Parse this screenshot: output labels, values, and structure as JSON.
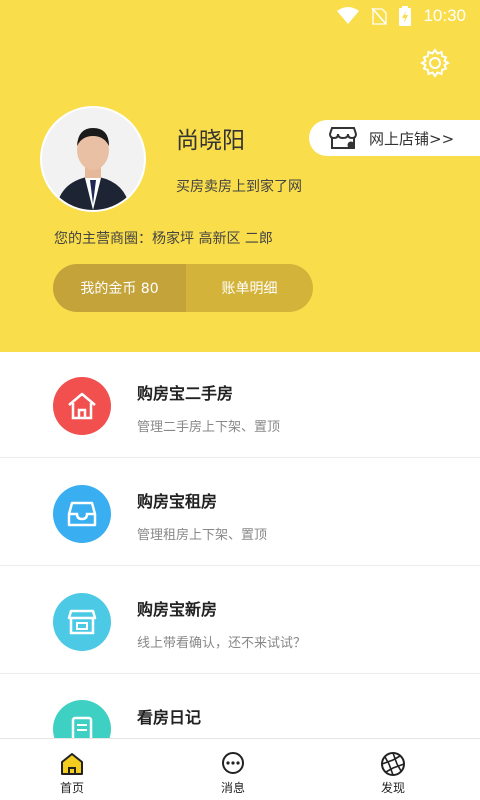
{
  "status": {
    "time": "10:30"
  },
  "profile": {
    "name": "尚晓阳",
    "slogan": "买房卖房上到家了网",
    "district": "您的主营商圈：杨家坪  高新区  二郎"
  },
  "shop": {
    "label": "网上店铺>>"
  },
  "coins": {
    "coins_label": "我的金币 80",
    "bill_label": "账单明细"
  },
  "services": [
    {
      "title": "购房宝二手房",
      "desc": "管理二手房上下架、置顶",
      "color": "#f1504f"
    },
    {
      "title": "购房宝租房",
      "desc": "管理租房上下架、置顶",
      "color": "#39aef0"
    },
    {
      "title": "购房宝新房",
      "desc": "线上带看确认，还不来试试？",
      "color": "#4cc9e5"
    },
    {
      "title": "看房日记",
      "desc": "",
      "color": "#3ed0c2"
    }
  ],
  "tabs": [
    {
      "label": "首页"
    },
    {
      "label": "消息"
    },
    {
      "label": "发现"
    }
  ],
  "colors": {
    "header": "#f9dd4a",
    "accent": "#f4cb1f"
  }
}
